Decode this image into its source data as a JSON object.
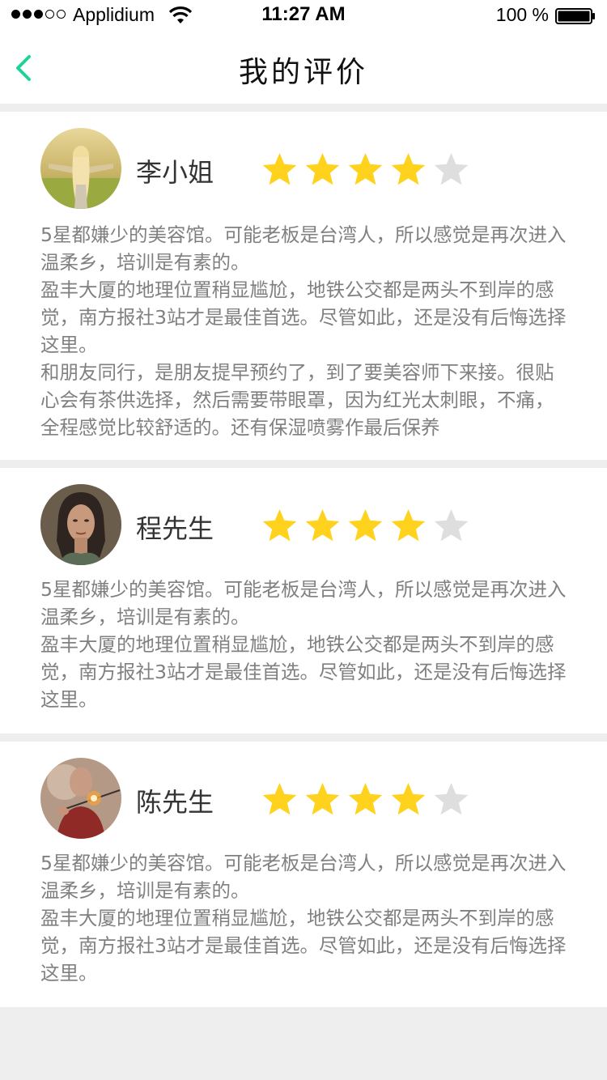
{
  "status_bar": {
    "carrier": "Applidium",
    "time": "11:27 AM",
    "battery": "100 %",
    "signal_bars": 3,
    "signal_total": 5
  },
  "nav": {
    "title": "我的评价",
    "back_icon": "chevron-left-icon",
    "accent_color": "#1ed39a"
  },
  "star_colors": {
    "filled": "#ffd21d",
    "empty": "#dedede"
  },
  "reviews": [
    {
      "name": "李小姐",
      "rating": 4,
      "max_rating": 5,
      "avatar": "woman-in-field-photo",
      "paragraphs": [
        "5星都嫌少的美容馆。可能老板是台湾人，所以感觉是再次进入温柔乡，培训是有素的。",
        "盈丰大厦的地理位置稍显尴尬，地铁公交都是两头不到岸的感觉，南方报社3站才是最佳首选。尽管如此，还是没有后悔选择这里。",
        "和朋友同行，是朋友提早预约了，到了要美容师下来接。很贴心会有茶供选择，然后需要带眼罩，因为红光太刺眼，不痛，全程感觉比较舒适的。还有保湿喷雾作最后保养"
      ]
    },
    {
      "name": "程先生",
      "rating": 4,
      "max_rating": 5,
      "avatar": "woman-portrait-photo",
      "paragraphs": [
        "5星都嫌少的美容馆。可能老板是台湾人，所以感觉是再次进入温柔乡，培训是有素的。",
        "盈丰大厦的地理位置稍显尴尬，地铁公交都是两头不到岸的感觉，南方报社3站才是最佳首选。尽管如此，还是没有后悔选择这里。"
      ]
    },
    {
      "name": "陈先生",
      "rating": 4,
      "max_rating": 5,
      "avatar": "sparkler-photo",
      "paragraphs": [
        "5星都嫌少的美容馆。可能老板是台湾人，所以感觉是再次进入温柔乡，培训是有素的。",
        "盈丰大厦的地理位置稍显尴尬，地铁公交都是两头不到岸的感觉，南方报社3站才是最佳首选。尽管如此，还是没有后悔选择这里。"
      ]
    }
  ]
}
